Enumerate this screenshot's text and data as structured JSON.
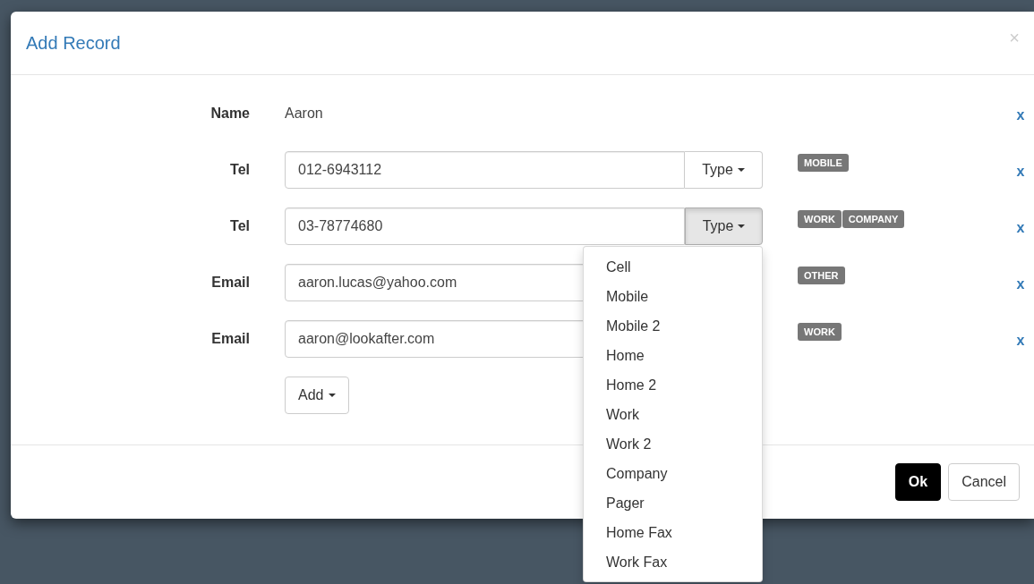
{
  "dialog": {
    "title": "Add Record",
    "close": "×"
  },
  "fields": [
    {
      "kind": "text",
      "label": "Name",
      "value": "Aaron",
      "remove": "x"
    },
    {
      "kind": "typed",
      "label": "Tel",
      "value": "012-6943112",
      "type_button": "Type",
      "menu_open": false,
      "tags": [
        "MOBILE"
      ],
      "remove": "x"
    },
    {
      "kind": "typed",
      "label": "Tel",
      "value": "03-78774680",
      "type_button": "Type",
      "menu_open": true,
      "tags": [
        "WORK",
        "COMPANY"
      ],
      "remove": "x"
    },
    {
      "kind": "input",
      "label": "Email",
      "value": "aaron.lucas@yahoo.com",
      "tags": [
        "OTHER"
      ],
      "remove": "x"
    },
    {
      "kind": "input",
      "label": "Email",
      "value": "aaron@lookafter.com",
      "tags": [
        "WORK"
      ],
      "remove": "x"
    }
  ],
  "add_button": "Add",
  "type_menu": [
    "Cell",
    "Mobile",
    "Mobile 2",
    "Home",
    "Home 2",
    "Work",
    "Work 2",
    "Company",
    "Pager",
    "Home Fax",
    "Work Fax"
  ],
  "footer": {
    "ok": "Ok",
    "cancel": "Cancel"
  }
}
